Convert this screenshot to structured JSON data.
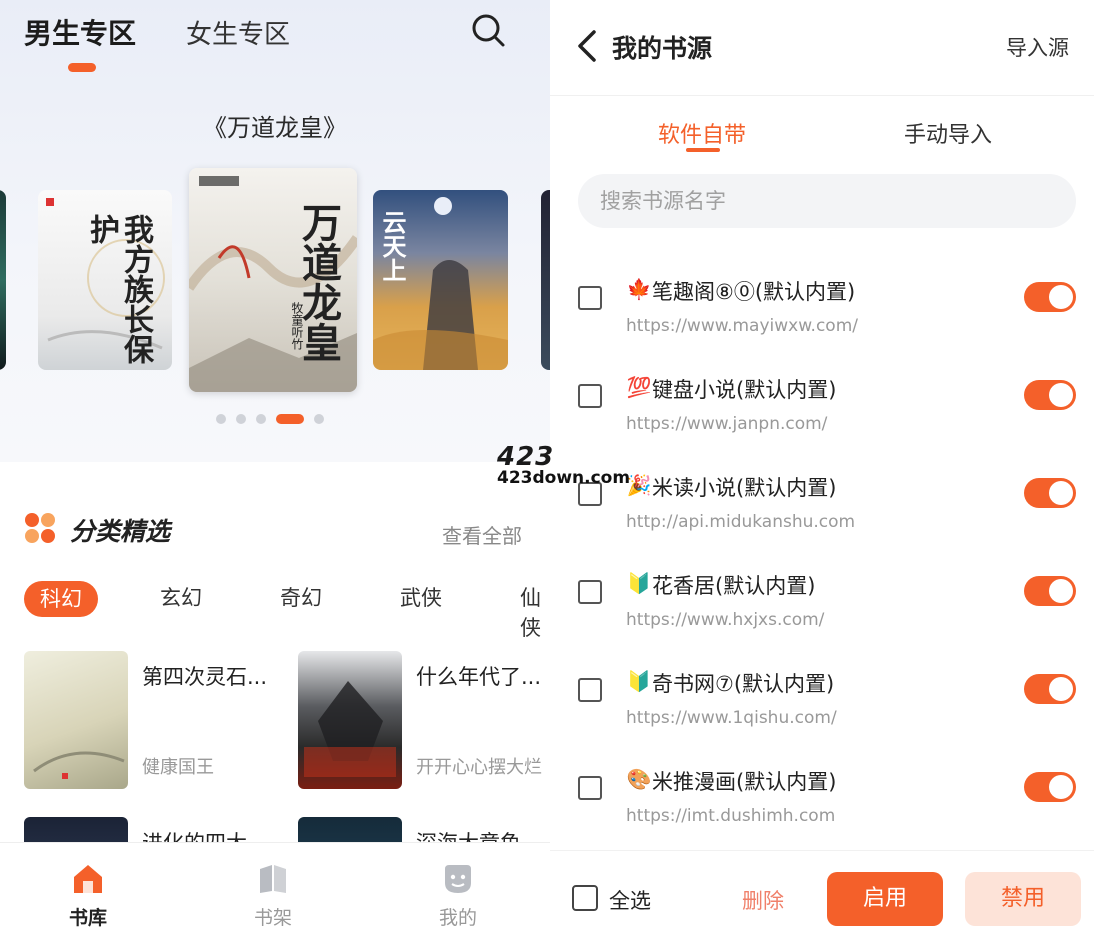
{
  "library": {
    "tabs": [
      {
        "label": "男生专区",
        "active": true
      },
      {
        "label": "女生专区",
        "active": false
      }
    ],
    "banner_title": "《万道龙皇》",
    "banner_covers": [
      {
        "title": "我方族长保护"
      },
      {
        "title": "万道龙皇",
        "author": "牧童听竹"
      },
      {
        "title": "云天上"
      }
    ],
    "carousel": {
      "count": 5,
      "active_index": 3
    },
    "section": {
      "title": "分类精选",
      "see_all": "查看全部"
    },
    "categories": [
      "科幻",
      "玄幻",
      "奇幻",
      "武侠",
      "仙侠"
    ],
    "active_category": "科幻",
    "books": [
      {
        "title": "第四次灵石...",
        "author": "健康国王"
      },
      {
        "title": "什么年代了...",
        "author": "开开心心摆大烂"
      },
      {
        "title": "进化的四大...",
        "author": ""
      },
      {
        "title": "深海大章鱼...",
        "author": ""
      }
    ],
    "nav": [
      {
        "label": "书库",
        "active": true
      },
      {
        "label": "书架",
        "active": false
      },
      {
        "label": "我的",
        "active": false
      }
    ]
  },
  "watermark": {
    "line1": "423",
    "line2": "423down.com"
  },
  "sources": {
    "title": "我的书源",
    "import_label": "导入源",
    "tabs": [
      {
        "label": "软件自带",
        "active": true
      },
      {
        "label": "手动导入",
        "active": false
      }
    ],
    "search_placeholder": "搜索书源名字",
    "items": [
      {
        "emoji": "🍁",
        "name": "笔趣阁⑧⓪(默认内置)",
        "url": "https://www.mayiwxw.com/",
        "enabled": true
      },
      {
        "emoji": "💯",
        "name": "键盘小说(默认内置)",
        "url": "https://www.janpn.com/",
        "enabled": true
      },
      {
        "emoji": "🎉",
        "name": "米读小说(默认内置)",
        "url": "http://api.midukanshu.com",
        "enabled": true
      },
      {
        "emoji": "🔰",
        "name": "花香居(默认内置)",
        "url": "https://www.hxjxs.com/",
        "enabled": true
      },
      {
        "emoji": "🔰",
        "name": "奇书网⑦(默认内置)",
        "url": "https://www.1qishu.com/",
        "enabled": true
      },
      {
        "emoji": "🎨",
        "name": "米推漫画(默认内置)",
        "url": "https://imt.dushimh.com",
        "enabled": true
      }
    ],
    "footer": {
      "select_all": "全选",
      "delete": "删除",
      "enable": "启用",
      "disable": "禁用"
    }
  },
  "colors": {
    "accent": "#f4602a",
    "accent_light": "#fde3d8"
  }
}
